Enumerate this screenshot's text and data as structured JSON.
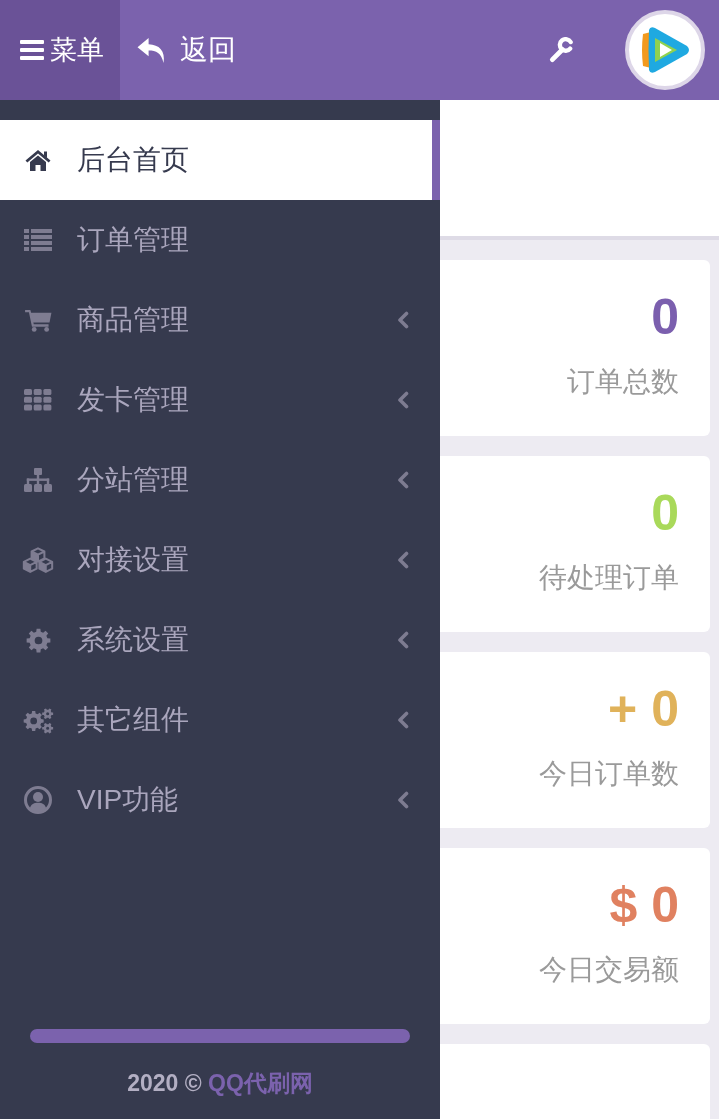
{
  "topbar": {
    "menu_button": "菜单",
    "back_button": "返回"
  },
  "sidebar": {
    "items": [
      {
        "label": "后台首页",
        "selected": true,
        "expandable": false
      },
      {
        "label": "订单管理",
        "selected": false,
        "expandable": false
      },
      {
        "label": "商品管理",
        "selected": false,
        "expandable": true
      },
      {
        "label": "发卡管理",
        "selected": false,
        "expandable": true
      },
      {
        "label": "分站管理",
        "selected": false,
        "expandable": true
      },
      {
        "label": "对接设置",
        "selected": false,
        "expandable": true
      },
      {
        "label": "系统设置",
        "selected": false,
        "expandable": true
      },
      {
        "label": "其它组件",
        "selected": false,
        "expandable": true
      },
      {
        "label": "VIP功能",
        "selected": false,
        "expandable": true
      }
    ]
  },
  "footer": {
    "text": "2020 ©",
    "link": "QQ代刷网"
  },
  "stats": [
    {
      "value": "0",
      "label": "订单总数",
      "color": "#7b5fae"
    },
    {
      "value": "0",
      "label": "待处理订单",
      "color": "#a9d95a"
    },
    {
      "value": "+ 0",
      "label": "今日订单数",
      "color": "#e0b25a"
    },
    {
      "value": "$ 0",
      "label": "今日交易额",
      "color": "#e08160"
    }
  ]
}
